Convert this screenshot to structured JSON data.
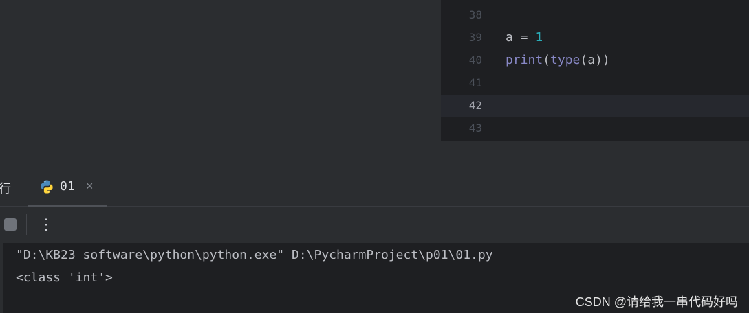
{
  "editor": {
    "lines": [
      {
        "num": "38",
        "code": ""
      },
      {
        "num": "39",
        "code_var": "a",
        "code_op": " = ",
        "code_num": "1"
      },
      {
        "num": "40",
        "code_fn": "print",
        "code_p1": "(",
        "code_fn2": "type",
        "code_rest": "(a))"
      },
      {
        "num": "41",
        "code": ""
      },
      {
        "num": "42",
        "code": ""
      },
      {
        "num": "43",
        "code": ""
      }
    ],
    "current_line": "42"
  },
  "run_panel": {
    "label": "行",
    "tab": {
      "label": "01",
      "icon": "python-icon",
      "close_glyph": "×"
    },
    "more_glyph": "⋮"
  },
  "console": {
    "lines": [
      "\"D:\\KB23 software\\python\\python.exe\" D:\\PycharmProject\\p01\\01.py",
      "<class 'int'>"
    ]
  },
  "watermark": "CSDN @请给我一串代码好吗",
  "colors": {
    "accent_number": "#2aacb8",
    "builtin": "#8888c6",
    "background": "#1e1f22",
    "panel": "#2b2d30"
  }
}
